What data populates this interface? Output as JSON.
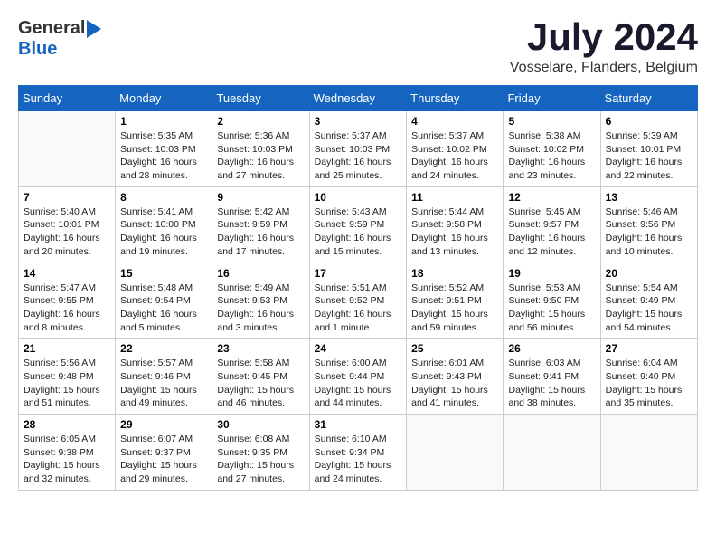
{
  "logo": {
    "general": "General",
    "blue": "Blue"
  },
  "title": {
    "month_year": "July 2024",
    "location": "Vosselare, Flanders, Belgium"
  },
  "headers": [
    "Sunday",
    "Monday",
    "Tuesday",
    "Wednesday",
    "Thursday",
    "Friday",
    "Saturday"
  ],
  "weeks": [
    [
      {
        "day": "",
        "sunrise": "",
        "sunset": "",
        "daylight": ""
      },
      {
        "day": "1",
        "sunrise": "Sunrise: 5:35 AM",
        "sunset": "Sunset: 10:03 PM",
        "daylight": "Daylight: 16 hours and 28 minutes."
      },
      {
        "day": "2",
        "sunrise": "Sunrise: 5:36 AM",
        "sunset": "Sunset: 10:03 PM",
        "daylight": "Daylight: 16 hours and 27 minutes."
      },
      {
        "day": "3",
        "sunrise": "Sunrise: 5:37 AM",
        "sunset": "Sunset: 10:03 PM",
        "daylight": "Daylight: 16 hours and 25 minutes."
      },
      {
        "day": "4",
        "sunrise": "Sunrise: 5:37 AM",
        "sunset": "Sunset: 10:02 PM",
        "daylight": "Daylight: 16 hours and 24 minutes."
      },
      {
        "day": "5",
        "sunrise": "Sunrise: 5:38 AM",
        "sunset": "Sunset: 10:02 PM",
        "daylight": "Daylight: 16 hours and 23 minutes."
      },
      {
        "day": "6",
        "sunrise": "Sunrise: 5:39 AM",
        "sunset": "Sunset: 10:01 PM",
        "daylight": "Daylight: 16 hours and 22 minutes."
      }
    ],
    [
      {
        "day": "7",
        "sunrise": "Sunrise: 5:40 AM",
        "sunset": "Sunset: 10:01 PM",
        "daylight": "Daylight: 16 hours and 20 minutes."
      },
      {
        "day": "8",
        "sunrise": "Sunrise: 5:41 AM",
        "sunset": "Sunset: 10:00 PM",
        "daylight": "Daylight: 16 hours and 19 minutes."
      },
      {
        "day": "9",
        "sunrise": "Sunrise: 5:42 AM",
        "sunset": "Sunset: 9:59 PM",
        "daylight": "Daylight: 16 hours and 17 minutes."
      },
      {
        "day": "10",
        "sunrise": "Sunrise: 5:43 AM",
        "sunset": "Sunset: 9:59 PM",
        "daylight": "Daylight: 16 hours and 15 minutes."
      },
      {
        "day": "11",
        "sunrise": "Sunrise: 5:44 AM",
        "sunset": "Sunset: 9:58 PM",
        "daylight": "Daylight: 16 hours and 13 minutes."
      },
      {
        "day": "12",
        "sunrise": "Sunrise: 5:45 AM",
        "sunset": "Sunset: 9:57 PM",
        "daylight": "Daylight: 16 hours and 12 minutes."
      },
      {
        "day": "13",
        "sunrise": "Sunrise: 5:46 AM",
        "sunset": "Sunset: 9:56 PM",
        "daylight": "Daylight: 16 hours and 10 minutes."
      }
    ],
    [
      {
        "day": "14",
        "sunrise": "Sunrise: 5:47 AM",
        "sunset": "Sunset: 9:55 PM",
        "daylight": "Daylight: 16 hours and 8 minutes."
      },
      {
        "day": "15",
        "sunrise": "Sunrise: 5:48 AM",
        "sunset": "Sunset: 9:54 PM",
        "daylight": "Daylight: 16 hours and 5 minutes."
      },
      {
        "day": "16",
        "sunrise": "Sunrise: 5:49 AM",
        "sunset": "Sunset: 9:53 PM",
        "daylight": "Daylight: 16 hours and 3 minutes."
      },
      {
        "day": "17",
        "sunrise": "Sunrise: 5:51 AM",
        "sunset": "Sunset: 9:52 PM",
        "daylight": "Daylight: 16 hours and 1 minute."
      },
      {
        "day": "18",
        "sunrise": "Sunrise: 5:52 AM",
        "sunset": "Sunset: 9:51 PM",
        "daylight": "Daylight: 15 hours and 59 minutes."
      },
      {
        "day": "19",
        "sunrise": "Sunrise: 5:53 AM",
        "sunset": "Sunset: 9:50 PM",
        "daylight": "Daylight: 15 hours and 56 minutes."
      },
      {
        "day": "20",
        "sunrise": "Sunrise: 5:54 AM",
        "sunset": "Sunset: 9:49 PM",
        "daylight": "Daylight: 15 hours and 54 minutes."
      }
    ],
    [
      {
        "day": "21",
        "sunrise": "Sunrise: 5:56 AM",
        "sunset": "Sunset: 9:48 PM",
        "daylight": "Daylight: 15 hours and 51 minutes."
      },
      {
        "day": "22",
        "sunrise": "Sunrise: 5:57 AM",
        "sunset": "Sunset: 9:46 PM",
        "daylight": "Daylight: 15 hours and 49 minutes."
      },
      {
        "day": "23",
        "sunrise": "Sunrise: 5:58 AM",
        "sunset": "Sunset: 9:45 PM",
        "daylight": "Daylight: 15 hours and 46 minutes."
      },
      {
        "day": "24",
        "sunrise": "Sunrise: 6:00 AM",
        "sunset": "Sunset: 9:44 PM",
        "daylight": "Daylight: 15 hours and 44 minutes."
      },
      {
        "day": "25",
        "sunrise": "Sunrise: 6:01 AM",
        "sunset": "Sunset: 9:43 PM",
        "daylight": "Daylight: 15 hours and 41 minutes."
      },
      {
        "day": "26",
        "sunrise": "Sunrise: 6:03 AM",
        "sunset": "Sunset: 9:41 PM",
        "daylight": "Daylight: 15 hours and 38 minutes."
      },
      {
        "day": "27",
        "sunrise": "Sunrise: 6:04 AM",
        "sunset": "Sunset: 9:40 PM",
        "daylight": "Daylight: 15 hours and 35 minutes."
      }
    ],
    [
      {
        "day": "28",
        "sunrise": "Sunrise: 6:05 AM",
        "sunset": "Sunset: 9:38 PM",
        "daylight": "Daylight: 15 hours and 32 minutes."
      },
      {
        "day": "29",
        "sunrise": "Sunrise: 6:07 AM",
        "sunset": "Sunset: 9:37 PM",
        "daylight": "Daylight: 15 hours and 29 minutes."
      },
      {
        "day": "30",
        "sunrise": "Sunrise: 6:08 AM",
        "sunset": "Sunset: 9:35 PM",
        "daylight": "Daylight: 15 hours and 27 minutes."
      },
      {
        "day": "31",
        "sunrise": "Sunrise: 6:10 AM",
        "sunset": "Sunset: 9:34 PM",
        "daylight": "Daylight: 15 hours and 24 minutes."
      },
      {
        "day": "",
        "sunrise": "",
        "sunset": "",
        "daylight": ""
      },
      {
        "day": "",
        "sunrise": "",
        "sunset": "",
        "daylight": ""
      },
      {
        "day": "",
        "sunrise": "",
        "sunset": "",
        "daylight": ""
      }
    ]
  ]
}
